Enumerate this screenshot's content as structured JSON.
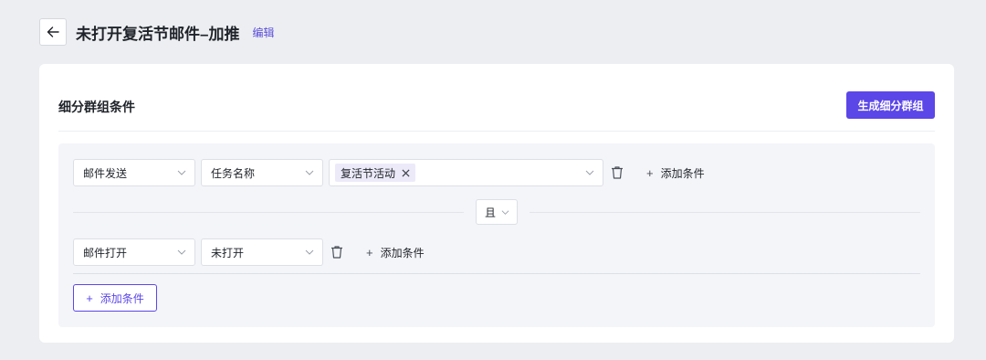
{
  "header": {
    "title": "未打开复活节邮件–加推",
    "edit_label": "编辑"
  },
  "card": {
    "title": "细分群组条件",
    "primary_button": "生成细分群组"
  },
  "condition_group_1": {
    "field": "邮件发送",
    "attribute": "任务名称",
    "tags": [
      "复活节活动"
    ],
    "add_condition": "添加条件"
  },
  "logic_operator": "且",
  "condition_group_2": {
    "field": "邮件打开",
    "value": "未打开",
    "add_condition": "添加条件"
  },
  "add_group_button": "添加条件",
  "colors": {
    "accent": "#5b46e8",
    "background": "#eceef1",
    "panel": "#f4f5f9"
  }
}
